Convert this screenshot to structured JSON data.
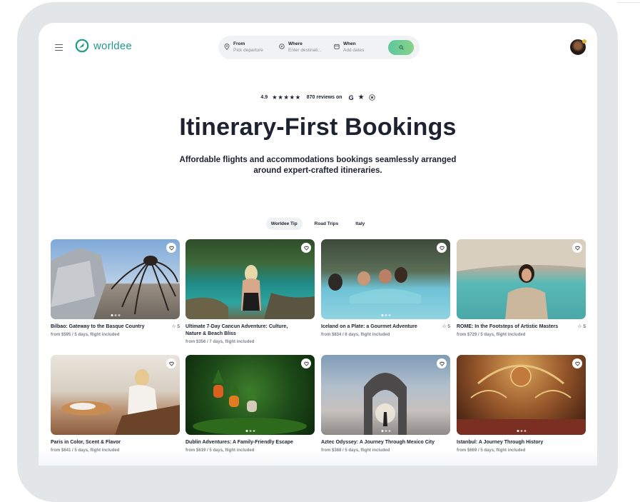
{
  "brand": {
    "name": "worldee",
    "color": "#1f9b8c"
  },
  "search": {
    "from": {
      "title": "From",
      "sub": "Pick departure"
    },
    "where": {
      "title": "Where",
      "sub": "Enter destinati..."
    },
    "when": {
      "title": "When",
      "sub": "Add dates"
    }
  },
  "rating": {
    "score": "4.9",
    "stars": "★★★★★",
    "reviews": "870 reviews on",
    "google": "G",
    "star_icon": "★"
  },
  "hero": {
    "title": "Itinerary-First Bookings",
    "subtitle_line1": "Affordable flights and accommodations bookings seamlessly arranged",
    "subtitle_line2": "around expert-crafted itineraries."
  },
  "tabs": [
    {
      "label": "Worldee Tip",
      "active": true
    },
    {
      "label": "Road Trips",
      "active": false
    },
    {
      "label": "Italy",
      "active": false
    }
  ],
  "cards": [
    {
      "name": "Bilbao: Gateway to the Basque Country",
      "rating": "☆ 5",
      "price": "from $595 / 5 days, flight included"
    },
    {
      "name": "Ultimate 7-Day Cancun Adventure: Culture, Nature & Beach Bliss",
      "rating": "",
      "price": "from $356 / 7 days, flight included"
    },
    {
      "name": "Iceland on a Plate: a Gourmet Adventure",
      "rating": "☆ 5",
      "price": "from $834 / 6 days, flight included"
    },
    {
      "name": "ROME: In the Footsteps of Artistic Masters",
      "rating": "☆ 5",
      "price": "from $729 / 5 days, flight included"
    },
    {
      "name": "Paris in Color, Scent & Flavor",
      "rating": "",
      "price": "from $641 / 5 days, flight included"
    },
    {
      "name": "Dublin Adventures: A Family-Friendly Escape",
      "rating": "",
      "price": "from $619 / 5 days, flight included"
    },
    {
      "name": "Aztec Odyssey: A Journey Through Mexico City",
      "rating": "",
      "price": "from $388 / 5 days, flight included"
    },
    {
      "name": "Istanbul: A Journey Through History",
      "rating": "",
      "price": "from $669 / 5 days, flight included"
    }
  ]
}
